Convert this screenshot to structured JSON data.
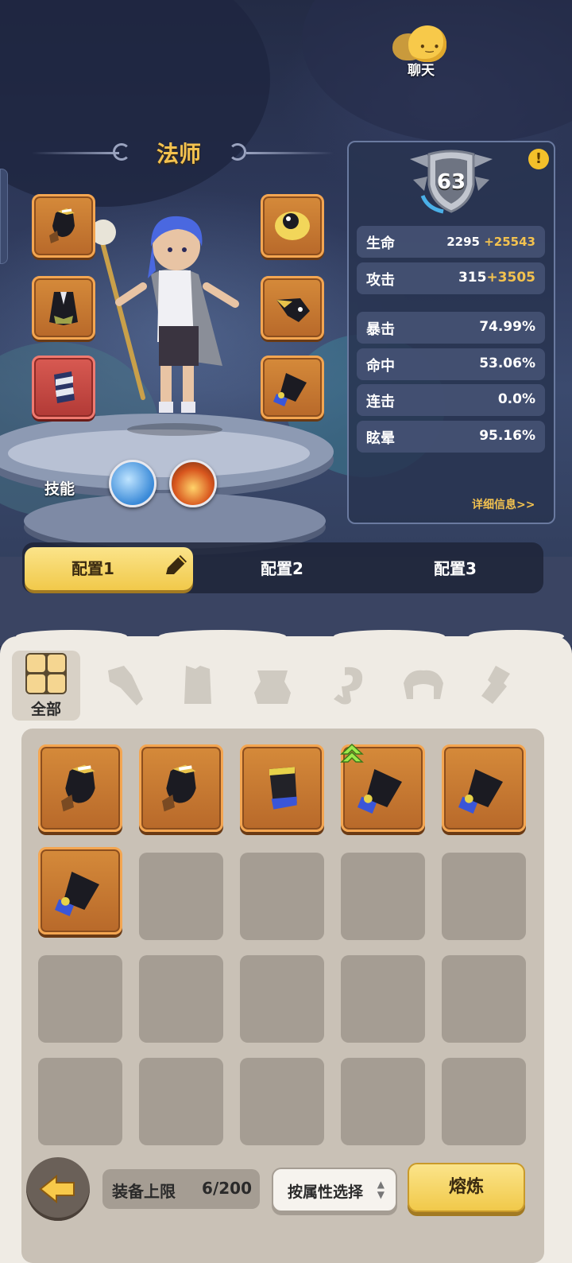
{
  "chat": {
    "label": "聊天",
    "icon": "chat-blob-icon"
  },
  "character": {
    "class_title": "法师"
  },
  "equipment_slots": {
    "left": [
      "helmet-icon",
      "cape-icon",
      "bracer-icon"
    ],
    "right": [
      "eye-orb-icon",
      "crow-mask-icon",
      "gauntlet-icon"
    ]
  },
  "skills": {
    "label": "技能",
    "items": [
      "ice-crystal-skill-icon",
      "fire-burst-skill-icon"
    ]
  },
  "stats": {
    "level": "63",
    "rows": [
      {
        "name": "生命",
        "base": "2295",
        "bonus": "+25543"
      },
      {
        "name": "攻击",
        "base": "315",
        "bonus": "+3505"
      },
      {
        "name": "暴击",
        "value": "74.99%"
      },
      {
        "name": "命中",
        "value": "53.06%"
      },
      {
        "name": "连击",
        "value": "0.0%"
      },
      {
        "name": "眩晕",
        "value": "95.16%"
      }
    ],
    "detail_link": "详细信息>>"
  },
  "config_tabs": [
    "配置1",
    "配置2",
    "配置3"
  ],
  "active_config": 0,
  "inventory": {
    "categories": [
      {
        "label": "全部",
        "icon": "all-grid-icon",
        "active": true
      },
      {
        "icon": "weapon-category-icon"
      },
      {
        "icon": "armor-category-icon"
      },
      {
        "icon": "belt-category-icon"
      },
      {
        "icon": "hook-category-icon"
      },
      {
        "icon": "headband-category-icon"
      },
      {
        "icon": "bracer-category-icon"
      }
    ],
    "items": [
      "helmet-icon",
      "helmet-icon",
      "bracer-icon",
      "gauntlet-icon",
      "gauntlet-icon",
      "gauntlet-icon"
    ],
    "upgrade_item_index": 3,
    "total_cells": 20,
    "capacity_label": "装备上限",
    "capacity_value": "6/200",
    "filter_label": "按属性选择",
    "smelt_label": "熔炼"
  },
  "colors": {
    "gold": "#f3c24f",
    "slot_orange": "#d58a3a",
    "panel": "#c9c1b6"
  }
}
